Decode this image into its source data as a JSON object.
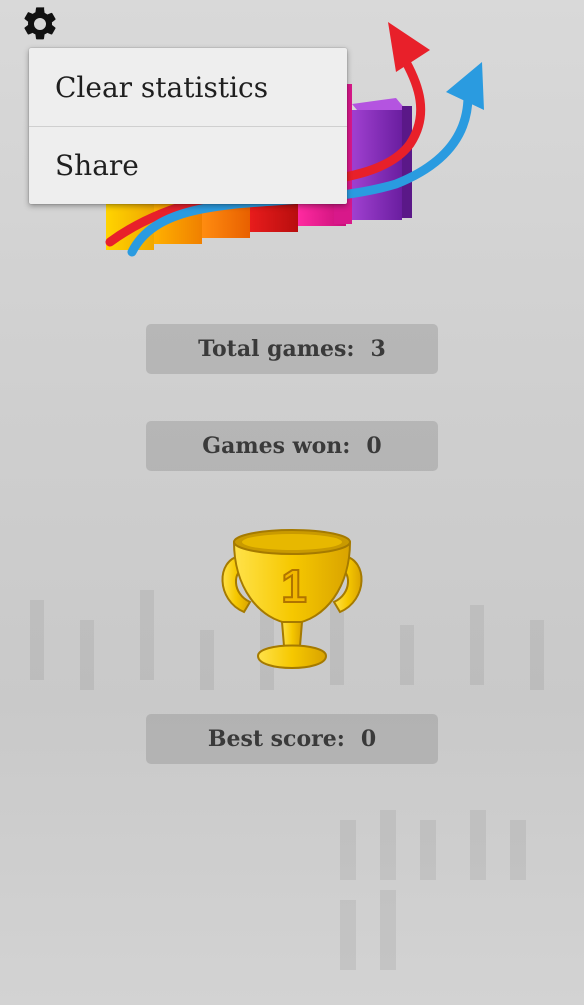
{
  "settings": {
    "icon": "gear-icon"
  },
  "menu": {
    "items": [
      {
        "label": "Clear statistics"
      },
      {
        "label": "Share"
      }
    ]
  },
  "stats": {
    "total_games": {
      "label": "Total games:",
      "value": "3"
    },
    "games_won": {
      "label": "Games won:",
      "value": "0"
    },
    "best_score": {
      "label": "Best score:",
      "value": "0"
    }
  },
  "trophy": {
    "number": "1"
  },
  "colors": {
    "background": "#d0d0d0",
    "menu_bg": "#eeeeee",
    "pill_bg": "#a9a9a9",
    "trophy_gold": "#f2c200",
    "arrow_red": "#e8202a",
    "arrow_blue": "#2a9be0"
  }
}
